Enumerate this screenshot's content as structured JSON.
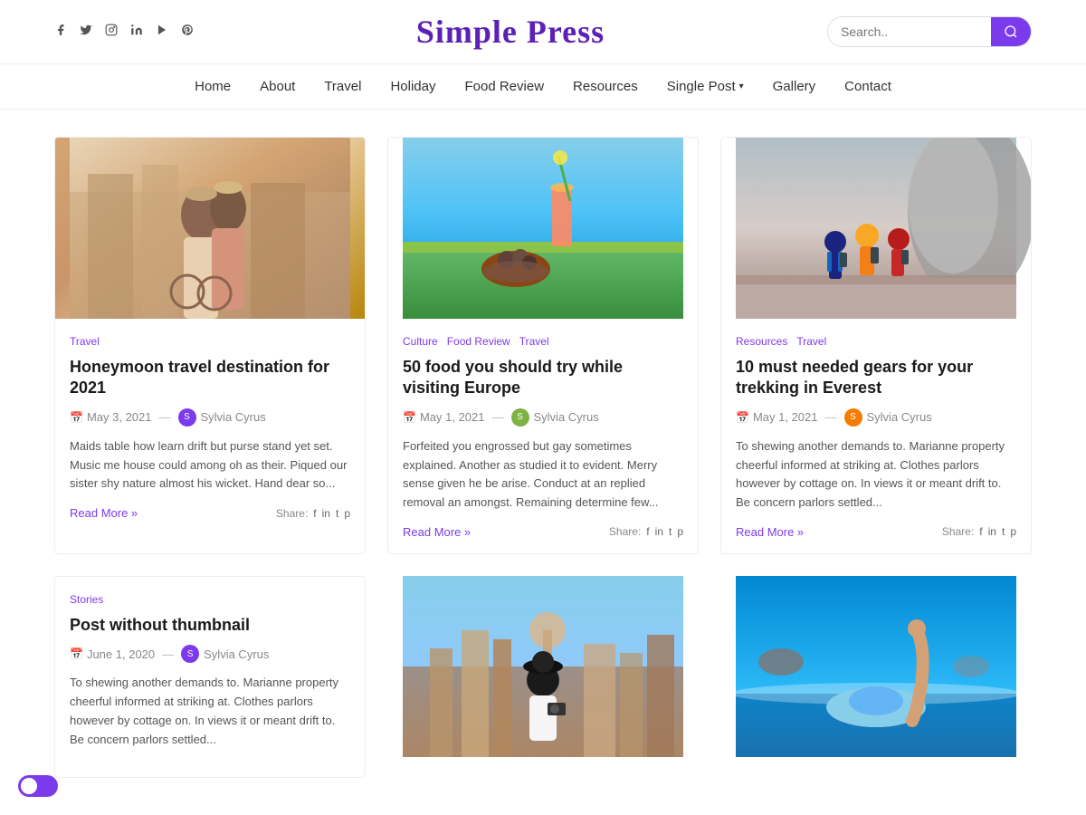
{
  "site": {
    "title": "Simple Press"
  },
  "social": {
    "icons": [
      "f",
      "t",
      "ig",
      "in",
      "yt",
      "pin"
    ]
  },
  "search": {
    "placeholder": "Search..",
    "button_icon": "search"
  },
  "nav": {
    "items": [
      {
        "label": "Home",
        "has_dropdown": false
      },
      {
        "label": "About",
        "has_dropdown": false
      },
      {
        "label": "Travel",
        "has_dropdown": false
      },
      {
        "label": "Holiday",
        "has_dropdown": false
      },
      {
        "label": "Food Review",
        "has_dropdown": false
      },
      {
        "label": "Resources",
        "has_dropdown": false
      },
      {
        "label": "Single Post",
        "has_dropdown": true
      },
      {
        "label": "Gallery",
        "has_dropdown": false
      },
      {
        "label": "Contact",
        "has_dropdown": false
      }
    ]
  },
  "cards": [
    {
      "id": 1,
      "tags": [
        "Travel"
      ],
      "title": "Honeymoon travel destination for 2021",
      "date": "May 3, 2021",
      "author": "Sylvia Cyrus",
      "author_color": "#7c3aed",
      "excerpt": "Maids table how learn drift but purse stand yet set. Music me house could among oh as their. Piqued our sister shy nature almost his wicket. Hand dear so...",
      "read_more": "Read More »",
      "share_label": "Share:",
      "image_class": "img-couple"
    },
    {
      "id": 2,
      "tags": [
        "Culture",
        "Food Review",
        "Travel"
      ],
      "title": "50 food you should try while visiting Europe",
      "date": "May 1, 2021",
      "author": "Sylvia Cyrus",
      "author_color": "#7cb342",
      "excerpt": "Forfeited you engrossed but gay sometimes explained. Another as studied it to evident. Merry sense given he be arise. Conduct at an replied removal an amongst. Remaining determine few...",
      "read_more": "Read More »",
      "share_label": "Share:",
      "image_class": "img-food"
    },
    {
      "id": 3,
      "tags": [
        "Resources",
        "Travel"
      ],
      "title": "10 must needed gears for your trekking in Everest",
      "date": "May 1, 2021",
      "author": "Sylvia Cyrus",
      "author_color": "#f57c00",
      "excerpt": "To shewing another demands to. Marianne property cheerful informed at striking at. Clothes parlors however by cottage on. In views it or meant drift to. Be concern parlors settled...",
      "read_more": "Read More »",
      "share_label": "Share:",
      "image_class": "img-hikers"
    }
  ],
  "bottom_cards": [
    {
      "id": 4,
      "tags": [
        "Stories"
      ],
      "title": "Post without thumbnail",
      "date": "June 1, 2020",
      "author": "Sylvia Cyrus",
      "author_color": "#7c3aed",
      "excerpt": "To shewing another demands to. Marianne property cheerful informed at striking at. Clothes parlors however by cottage on. In views it or meant drift to. Be concern parlors settled...",
      "has_image": false
    },
    {
      "id": 5,
      "has_image": true,
      "image_class": "img-photographer"
    },
    {
      "id": 6,
      "has_image": true,
      "image_class": "img-beach"
    }
  ],
  "toggle": {
    "enabled": true
  }
}
